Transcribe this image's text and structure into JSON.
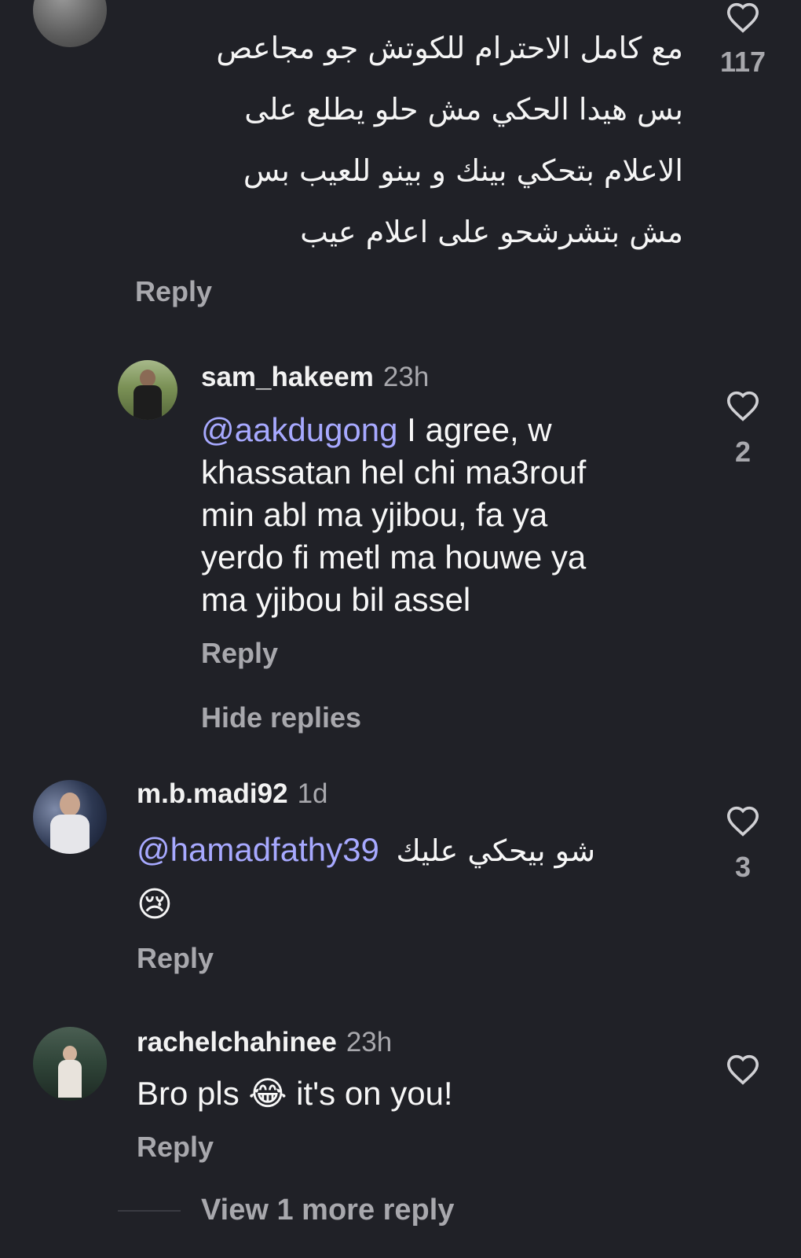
{
  "comments": [
    {
      "username": "",
      "time": "",
      "lines": [
        "مع كامل الاحترام للكوتش جو  مجاعص",
        "بس هيدا الحكي مش حلو يطلع على",
        "الاعلام بتحكي بينك و بينو للعيب بس",
        "مش بتشرشحو على اعلام عيب"
      ],
      "likes": "117",
      "reply": "Reply"
    },
    {
      "username": "sam_hakeem",
      "time": "23h",
      "mention": "@aakdugong",
      "lines": [
        " I agree, w",
        "khassatan hel chi ma3rouf",
        "min abl ma yjibou, fa ya",
        "yerdo fi metl ma houwe ya",
        "ma yjibou bil assel"
      ],
      "likes": "2",
      "reply": "Reply",
      "hide_replies": "Hide replies"
    },
    {
      "username": "m.b.madi92",
      "time": "1d",
      "mention": "@hamadfathy39",
      "text": "شو بيحكي عليك",
      "emoji": "😢",
      "likes": "3",
      "reply": "Reply"
    },
    {
      "username": "rachelchahinee",
      "time": "23h",
      "text_before": "Bro pls ",
      "emoji": "😂",
      "text_after": " it's on you!",
      "likes": "",
      "reply": "Reply",
      "view_more": "View 1 more reply"
    }
  ],
  "colors": {
    "background": "#202127",
    "mention": "#a7a9ff",
    "muted": "#a8a8ad"
  },
  "icons": {
    "like": "heart-outline-icon"
  }
}
